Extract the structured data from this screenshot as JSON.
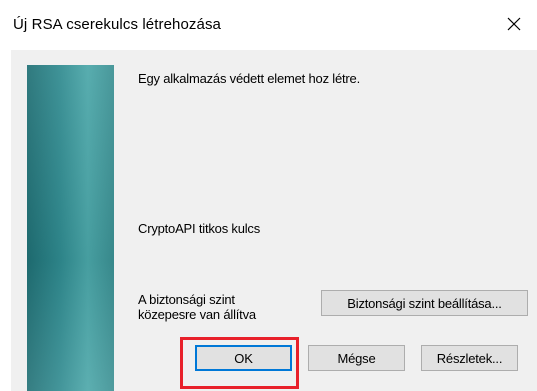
{
  "window": {
    "title": "Új RSA cserekulcs létrehozása"
  },
  "content": {
    "message": "Egy alkalmazás védett elemet hoz létre.",
    "key_name": "CryptoAPI titkos kulcs",
    "security_level_line1": "A biztonsági szint",
    "security_level_line2": "közepesre van állítva"
  },
  "buttons": {
    "set_security_level": "Biztonsági szint beállítása...",
    "ok": "OK",
    "cancel": "Mégse",
    "details": "Részletek..."
  },
  "colors": {
    "banner": "#2f8a8f",
    "highlight": "#e8202a",
    "focus_border": "#0078d7"
  },
  "icons": {
    "close": "close-icon"
  }
}
